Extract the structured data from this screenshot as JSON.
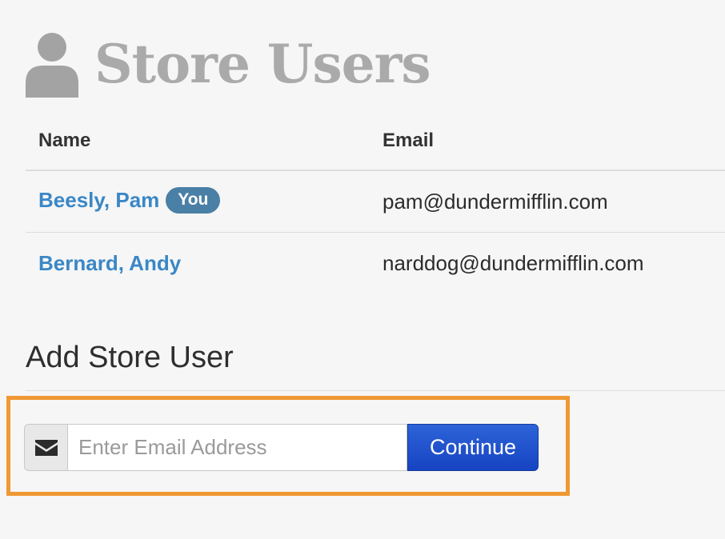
{
  "page": {
    "title": "Store Users",
    "title_icon": "user-icon"
  },
  "users_table": {
    "headers": {
      "name": "Name",
      "email": "Email"
    },
    "rows": [
      {
        "name": "Beesly, Pam",
        "badge": "You",
        "email": "pam@dundermifflin.com"
      },
      {
        "name": "Bernard, Andy",
        "email": "narddog@dundermifflin.com"
      }
    ]
  },
  "add_user": {
    "heading": "Add Store User",
    "addon_icon": "envelope-icon",
    "email_value": "",
    "email_placeholder": "Enter Email Address",
    "continue_label": "Continue"
  },
  "colors": {
    "title": "#aaaaaa",
    "link": "#3a87c6",
    "badge": "#4a7fa6",
    "button": "#1b4fd0",
    "highlight_border": "#ef9834"
  }
}
